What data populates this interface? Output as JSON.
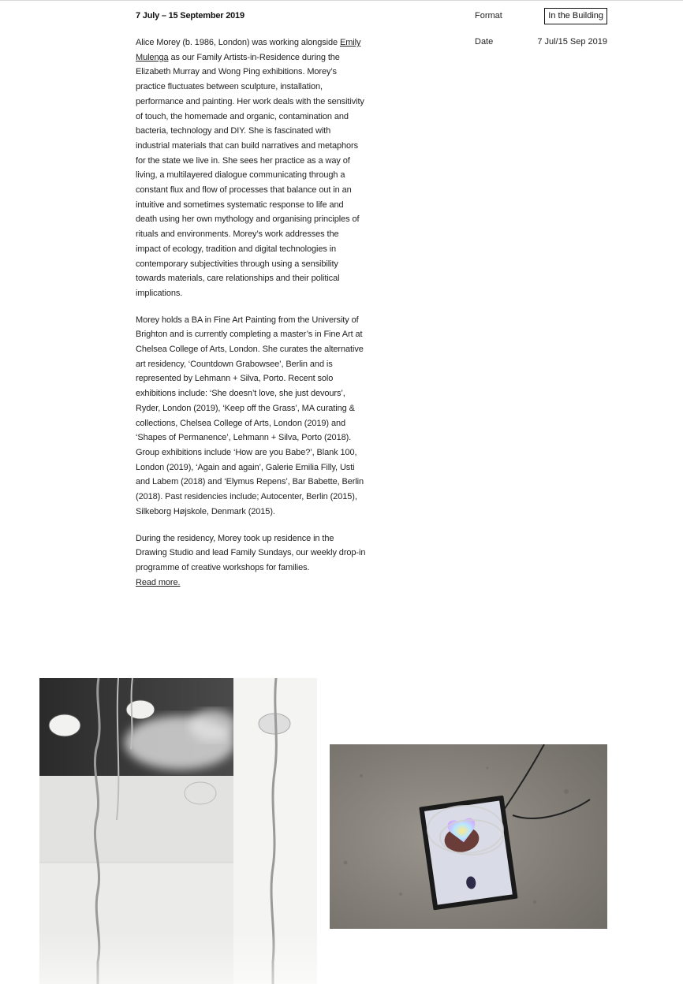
{
  "event": {
    "dates": "7 July – 15 September 2019"
  },
  "meta": {
    "format_label": "Format",
    "format_value": "In the Building",
    "date_label": "Date",
    "date_value": "7 Jul/15 Sep 2019"
  },
  "description": {
    "p1_before_link": "Alice Morey (b. 1986, London) was working alongside ",
    "p1_link": "Emily Mulenga",
    "p1_after_link": " as our Family Artists-in-Residence during the Elizabeth Murray and Wong Ping exhibitions. Morey’s practice fluctuates between sculpture, installation, performance and painting. Her work deals with the sensitivity of touch, the homemade and organic, contamination and bacteria, technology and DIY. She is fascinated with industrial materials that can build narratives and metaphors for the state we live in. She sees her practice as a way of living, a multilayered dialogue communicating through a constant flux and flow of processes that balance out in an intuitive and sometimes systematic response to life and death using her own mythology and organising principles of rituals and environments. Morey’s work addresses the impact of ecology, tradition and digital technologies in contemporary subjectivities through using a sensibility towards materials, care relationships and their political implications.",
    "p2": "Morey holds a BA in Fine Art Painting from the University of Brighton and is currently completing a master’s in Fine Art at Chelsea College of Arts, London. She curates the alternative art residency, ‘Countdown Grabowsee’, Berlin and is represented by Lehmann + Silva, Porto. Recent solo exhibitions include: ‘She doesn’t love, she just devours’, Ryder, London (2019), ‘Keep off the Grass’, MA curating & collections, Chelsea College of Arts, London (2019) and ‘Shapes of Permanence’, Lehmann + Silva, Porto (2018). Group exhibitions include ‘How are you Babe?’, Blank 100, London (2019), ‘Again and again’, Galerie Emilia Filly, Usti and Labem (2018) and ‘Elymus Repens’, Bar Babette, Berlin (2018). Past residencies include; Autocenter, Berlin (2015), Silkeborg Højskole, Denmark (2015).",
    "p3": "During the residency, Morey took up residence in the Drawing Studio and lead Family Sundays, our weekly drop-in programme of creative workshops for families.",
    "read_more": "Read more."
  },
  "images": [
    {
      "icon": "artwork-photo-chains-drawing"
    },
    {
      "icon": "artwork-photo-screen-on-floor"
    }
  ]
}
